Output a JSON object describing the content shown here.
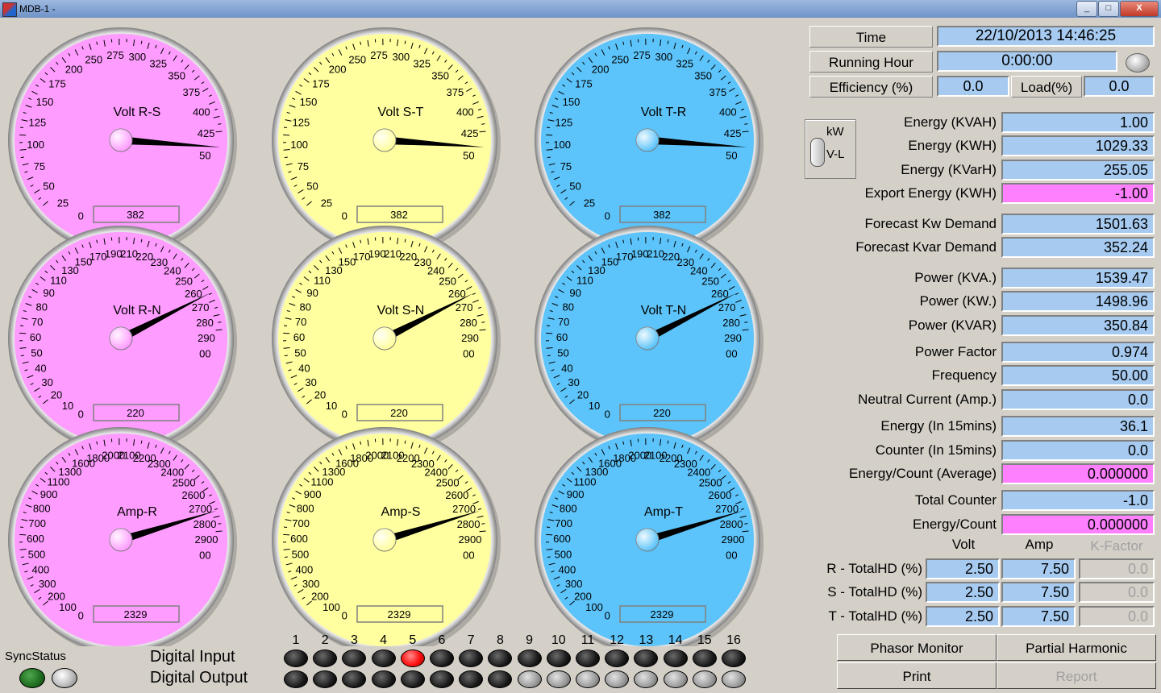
{
  "window": {
    "title": "MDB-1 -",
    "minimize": "_",
    "maximize": "□",
    "close": "X"
  },
  "header": {
    "time_label": "Time",
    "time_value": "22/10/2013   14:46:25",
    "running_label": "Running Hour",
    "running_value": "0:00:00",
    "efficiency_label": "Efficiency (%)",
    "efficiency_value": "0.0",
    "load_label": "Load(%)",
    "load_value": "0.0"
  },
  "toggle": {
    "top": "kW",
    "bottom": "V-L"
  },
  "readings": [
    {
      "label": "Energy (KVAH)",
      "value": "1.00",
      "highlight": false
    },
    {
      "label": "Energy (KWH)",
      "value": "1029.33",
      "highlight": false
    },
    {
      "label": "Energy (KVarH)",
      "value": "255.05",
      "highlight": false
    },
    {
      "label": "Export Energy (KWH)",
      "value": "-1.00",
      "highlight": true
    },
    {
      "label": "Forecast Kw Demand",
      "value": "1501.63",
      "highlight": false
    },
    {
      "label": "Forecast Kvar Demand",
      "value": "352.24",
      "highlight": false
    },
    {
      "label": "Power (KVA.)",
      "value": "1539.47",
      "highlight": false
    },
    {
      "label": "Power (KW.)",
      "value": "1498.96",
      "highlight": false
    },
    {
      "label": "Power (KVAR)",
      "value": "350.84",
      "highlight": false
    },
    {
      "label": "Power Factor",
      "value": "0.974",
      "highlight": false
    },
    {
      "label": "Frequency",
      "value": "50.00",
      "highlight": false
    },
    {
      "label": "Neutral Current (Amp.)",
      "value": "0.0",
      "highlight": false
    },
    {
      "label": "Energy (In 15mins)",
      "value": "36.1",
      "highlight": false
    },
    {
      "label": "Counter (In 15mins)",
      "value": "0.0",
      "highlight": false
    },
    {
      "label": "Energy/Count (Average)",
      "value": "0.000000",
      "highlight": true
    },
    {
      "label": "Total Counter",
      "value": "-1.0",
      "highlight": false
    },
    {
      "label": "Energy/Count",
      "value": "0.000000",
      "highlight": true
    }
  ],
  "thd": {
    "headers": [
      "Volt",
      "Amp",
      "K-Factor"
    ],
    "rows": [
      {
        "label": "R - TotalHD (%)",
        "volt": "2.50",
        "amp": "7.50",
        "k": "0.0"
      },
      {
        "label": "S - TotalHD (%)",
        "volt": "2.50",
        "amp": "7.50",
        "k": "0.0"
      },
      {
        "label": "T - TotalHD (%)",
        "volt": "2.50",
        "amp": "7.50",
        "k": "0.0"
      }
    ]
  },
  "buttons": {
    "phasor": "Phasor Monitor",
    "harmonic": "Partial Harmonic",
    "print": "Print",
    "report": "Report"
  },
  "io": {
    "sync_label": "SyncStatus",
    "digital_input_label": "Digital Input",
    "digital_output_label": "Digital Output",
    "channels": [
      "1",
      "2",
      "3",
      "4",
      "5",
      "6",
      "7",
      "8",
      "9",
      "10",
      "11",
      "12",
      "13",
      "14",
      "15",
      "16"
    ],
    "inputs_on": [
      5
    ],
    "outputs_active_count": 8
  },
  "colors": {
    "phase_r": "#ff9cff",
    "phase_s": "#ffff9f",
    "phase_t": "#5cc4fa",
    "value_bg": "#a6caf0",
    "alarm_bg": "#ff80ff",
    "led_on": "#ff1010",
    "sync_led": "#1e6b1e"
  },
  "gauges": [
    {
      "title": "Volt R-S",
      "value": 382,
      "readout": "382",
      "face": "#ff9cff",
      "knob": "#ff9cff",
      "ticks": [
        "0",
        "25",
        "50",
        "75",
        "100",
        "125",
        "150",
        "175",
        "200",
        "250",
        "275",
        "300",
        "325",
        "350",
        "375",
        "400",
        "425",
        "50"
      ]
    },
    {
      "title": "Volt S-T",
      "value": 382,
      "readout": "382",
      "face": "#ffff9f",
      "knob": "#ffff9f",
      "ticks": [
        "0",
        "25",
        "50",
        "75",
        "100",
        "125",
        "150",
        "175",
        "200",
        "250",
        "275",
        "300",
        "325",
        "350",
        "375",
        "400",
        "425",
        "50"
      ]
    },
    {
      "title": "Volt T-R",
      "value": 382,
      "readout": "382",
      "face": "#5cc4fa",
      "knob": "#5cc4fa",
      "ticks": [
        "0",
        "25",
        "50",
        "75",
        "100",
        "125",
        "150",
        "175",
        "200",
        "250",
        "275",
        "300",
        "325",
        "350",
        "375",
        "400",
        "425",
        "50"
      ]
    },
    {
      "title": "Volt R-N",
      "value": 220,
      "readout": "220",
      "face": "#ff9cff",
      "knob": "#ff9cff",
      "ticks": [
        "0",
        "10",
        "20",
        "30",
        "40",
        "50",
        "60",
        "70",
        "80",
        "90",
        "110",
        "130",
        "150",
        "170",
        "190",
        "210",
        "220",
        "230",
        "240",
        "250",
        "260",
        "270",
        "280",
        "290",
        "00"
      ]
    },
    {
      "title": "Volt S-N",
      "value": 220,
      "readout": "220",
      "face": "#ffff9f",
      "knob": "#ffff9f",
      "ticks": [
        "0",
        "10",
        "20",
        "30",
        "40",
        "50",
        "60",
        "70",
        "80",
        "90",
        "110",
        "130",
        "150",
        "170",
        "190",
        "210",
        "220",
        "230",
        "240",
        "250",
        "260",
        "270",
        "280",
        "290",
        "00"
      ]
    },
    {
      "title": "Volt T-N",
      "value": 220,
      "readout": "220",
      "face": "#5cc4fa",
      "knob": "#5cc4fa",
      "ticks": [
        "0",
        "10",
        "20",
        "30",
        "40",
        "50",
        "60",
        "70",
        "80",
        "90",
        "110",
        "130",
        "150",
        "170",
        "190",
        "210",
        "220",
        "230",
        "240",
        "250",
        "260",
        "270",
        "280",
        "290",
        "00"
      ]
    },
    {
      "title": "Amp-R",
      "value": 2329,
      "readout": "2329",
      "face": "#ff9cff",
      "knob": "#ff9cff",
      "ticks": [
        "0",
        "100",
        "200",
        "300",
        "400",
        "500",
        "600",
        "700",
        "800",
        "900",
        "1100",
        "1300",
        "1600",
        "1800",
        "2000",
        "2100",
        "2200",
        "2300",
        "2400",
        "2500",
        "2600",
        "2700",
        "2800",
        "2900",
        "00"
      ]
    },
    {
      "title": "Amp-S",
      "value": 2329,
      "readout": "2329",
      "face": "#ffff9f",
      "knob": "#ffff9f",
      "ticks": [
        "0",
        "100",
        "200",
        "300",
        "400",
        "500",
        "600",
        "700",
        "800",
        "900",
        "1100",
        "1300",
        "1600",
        "1800",
        "2000",
        "2100",
        "2200",
        "2300",
        "2400",
        "2500",
        "2600",
        "2700",
        "2800",
        "2900",
        "00"
      ]
    },
    {
      "title": "Amp-T",
      "value": 2329,
      "readout": "2329",
      "face": "#5cc4fa",
      "knob": "#5cc4fa",
      "ticks": [
        "0",
        "100",
        "200",
        "300",
        "400",
        "500",
        "600",
        "700",
        "800",
        "900",
        "1100",
        "1300",
        "1600",
        "1800",
        "2000",
        "2100",
        "2200",
        "2300",
        "2400",
        "2500",
        "2600",
        "2700",
        "2800",
        "2900",
        "00"
      ]
    }
  ]
}
